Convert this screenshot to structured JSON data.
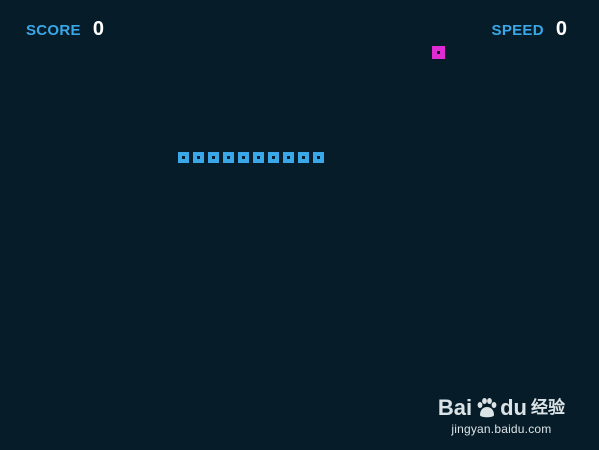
{
  "hud": {
    "score_label": "SCORE",
    "score_value": "0",
    "speed_label": "SPEED",
    "speed_value": "0"
  },
  "game": {
    "snake_segments": 10,
    "colors": {
      "background": "#061c28",
      "snake": "#3aa7e8",
      "food": "#e02bd3",
      "hud_label": "#3aa7e8",
      "hud_value": "#ffffff"
    }
  },
  "watermark": {
    "brand_left": "Bai",
    "brand_right": "du",
    "product": "经验",
    "url": "jingyan.baidu.com",
    "icon": "paw-icon"
  }
}
